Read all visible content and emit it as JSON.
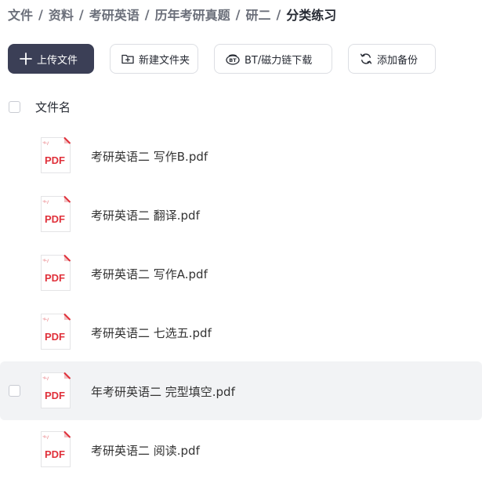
{
  "breadcrumb": [
    {
      "label": "文件"
    },
    {
      "label": "资料"
    },
    {
      "label": "考研英语"
    },
    {
      "label": "历年考研真题"
    },
    {
      "label": "研二"
    },
    {
      "label": "分类练习"
    }
  ],
  "breadcrumb_separator": "/",
  "toolbar": {
    "upload_label": "上传文件",
    "new_folder_label": "新建文件夹",
    "bt_label": "BT/磁力链下载",
    "backup_label": "添加备份"
  },
  "list": {
    "column_name": "文件名",
    "files": [
      {
        "name": "考研英语二 写作B.pdf",
        "icon": "pdf-icon",
        "icon_text": "PDF"
      },
      {
        "name": "考研英语二 翻译.pdf",
        "icon": "pdf-icon",
        "icon_text": "PDF"
      },
      {
        "name": "考研英语二 写作A.pdf",
        "icon": "pdf-icon",
        "icon_text": "PDF"
      },
      {
        "name": "考研英语二 七选五.pdf",
        "icon": "pdf-icon",
        "icon_text": "PDF"
      },
      {
        "name": "年考研英语二  完型填空.pdf",
        "icon": "pdf-icon",
        "icon_text": "PDF"
      },
      {
        "name": "考研英语二 阅读.pdf",
        "icon": "pdf-icon",
        "icon_text": "PDF"
      }
    ]
  },
  "colors": {
    "primary_button": "#3b3f56",
    "pdf_red": "#e0303a",
    "hover_row": "#f2f3f5"
  }
}
